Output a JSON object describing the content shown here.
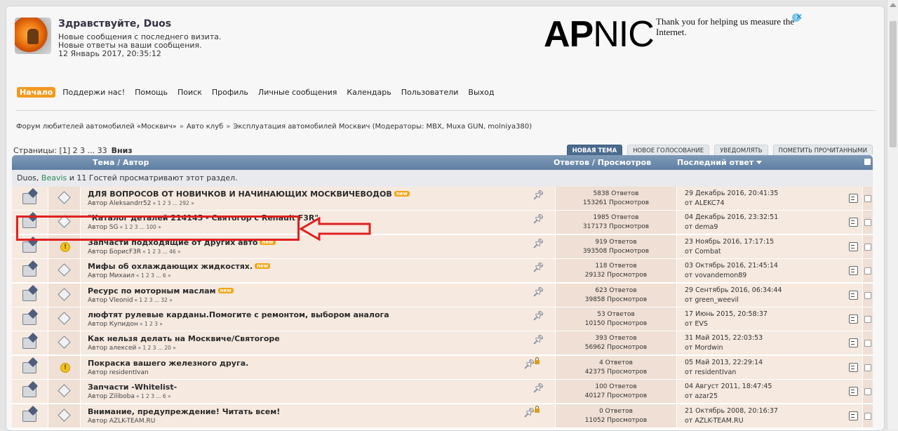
{
  "header": {
    "greeting": "Здравствуйте, Duos",
    "lines": [
      "Новые сообщения с последнего визита.",
      "Новые ответы на ваши сообщения.",
      "12 Январь 2017, 20:35:12"
    ]
  },
  "ad": {
    "logo_bold": "AP",
    "logo_regular": "NIC",
    "text": "Thank you for helping us measure the Internet.",
    "info_glyph": "i",
    "close_glyph": "✕"
  },
  "nav": [
    "Начало",
    "Поддержи нас!",
    "Помощь",
    "Поиск",
    "Профиль",
    "Личные сообщения",
    "Календарь",
    "Пользователи",
    "Выход"
  ],
  "breadcrumb": {
    "items": [
      "Форум любителей автомобилей «Москвич»",
      "Авто клуб",
      "Эксплуатация автомобилей Москвич (Модераторы: MBX, Muxa GUN, molniya380)"
    ],
    "separator": "»"
  },
  "pagination": {
    "label": "Страницы: [1] 2 3 ... 33",
    "down": "Вниз"
  },
  "buttons": [
    "НОВАЯ ТЕМА",
    "НОВОЕ ГОЛОСОВАНИЕ",
    "УВЕДОМЛЯТЬ",
    "ПОМЕТИТЬ ПРОЧИТАННЫМИ"
  ],
  "table_head": {
    "topic": "Тема / Автор",
    "stats": "Ответов / Просмотров",
    "last": "Последний ответ"
  },
  "viewers": {
    "a": "Duos, ",
    "b": "Beavis",
    "c": " и 11 Гостей просматривают этот раздел."
  },
  "topics": [
    {
      "title": "ДЛЯ ВОПРОСОВ ОТ НОВИЧКОВ И НАЧИНАЮЩИХ МОСКВИЧЕВОДОВ",
      "new": "new",
      "author": "Автор Aleksandrr52",
      "pages": "« 1 2 3 ... 292 »",
      "replies": "5838 Ответов",
      "views": "153261 Просмотров",
      "last_date": "29 Декабрь 2016, 20:41:35",
      "last_by": "от ALEKC74",
      "icon": "diamond",
      "locked": false
    },
    {
      "title": "\"Каталог деталей 214145 - Святогор с Renault F3R\"",
      "new": "",
      "author": "Автор SG",
      "pages": "« 1 2 3 ... 100 »",
      "replies": "1985 Ответов",
      "views": "317173 Просмотров",
      "last_date": "04 Декабрь 2016, 23:32:51",
      "last_by": "от dema9",
      "icon": "diamond",
      "locked": false
    },
    {
      "title": "Запчасти подходящие от других авто",
      "new": "new",
      "author": "Автор БорисF3R",
      "pages": "« 1 2 3 ... 46 »",
      "replies": "919 Ответов",
      "views": "393508 Просмотров",
      "last_date": "23 Ноябрь 2016, 17:17:15",
      "last_by": "от Combat",
      "icon": "warn",
      "locked": false
    },
    {
      "title": "Мифы об охлаждающих жидкостях.",
      "new": "new",
      "author": "Автор Михаил",
      "pages": "« 1 2 3 ... 6 »",
      "replies": "118 Ответов",
      "views": "29132 Просмотров",
      "last_date": "03 Октябрь 2016, 21:45:14",
      "last_by": "от vovandemon89",
      "icon": "diamond",
      "locked": false
    },
    {
      "title": "Ресурс по моторным маслам",
      "new": "new",
      "author": "Автор Vleonid",
      "pages": "« 1 2 3 ... 32 »",
      "replies": "623 Ответов",
      "views": "39858 Просмотров",
      "last_date": "29 Сентябрь 2016, 06:34:44",
      "last_by": "от green_weevil",
      "icon": "diamond",
      "locked": false
    },
    {
      "title": "люфтят рулевые карданы.Помогите с ремонтом, выбором аналога",
      "new": "",
      "author": "Автор Купидон",
      "pages": "« 1 2 3 »",
      "replies": "53 Ответов",
      "views": "10150 Просмотров",
      "last_date": "17 Июнь 2015, 20:58:37",
      "last_by": "от EVS",
      "icon": "diamond",
      "locked": false
    },
    {
      "title": "Как нельзя делать на Москвиче/Святогоре",
      "new": "",
      "author": "Автор алексей",
      "pages": "« 1 2 3 ... 20 »",
      "replies": "393 Ответов",
      "views": "56962 Просмотров",
      "last_date": "31 Май 2015, 22:03:53",
      "last_by": "от Mordwin",
      "icon": "diamond",
      "locked": false
    },
    {
      "title": "Покраска вашего железного друга.",
      "new": "",
      "author": "Автор residentIvan",
      "pages": "",
      "replies": "4 Ответов",
      "views": "42375 Просмотров",
      "last_date": "05 Май 2013, 22:29:14",
      "last_by": "от residentIvan",
      "icon": "warn",
      "locked": true
    },
    {
      "title": "Запчасти -Whitelist-",
      "new": "",
      "author": "Автор Ziliboba",
      "pages": "« 1 2 3 ... 6 »",
      "replies": "100 Ответов",
      "views": "40127 Просмотров",
      "last_date": "04 Август 2011, 18:47:45",
      "last_by": "от azar25",
      "icon": "diamond",
      "locked": false
    },
    {
      "title": "Внимание, предупреждение! Читать всем!",
      "new": "",
      "author": "Автор AZLK-TEAM.RU",
      "pages": "",
      "replies": "0 Ответов",
      "views": "11052 Просмотров",
      "last_date": "21 Октябрь 2008, 20:16:37",
      "last_by": "от AZLK-TEAM.RU",
      "icon": "diamond",
      "locked": true
    }
  ],
  "colors": {
    "accent_nav": "#f29a1f",
    "header_bar": "#5f7fa3",
    "highlight": "#e0201f",
    "new_badge": "#f2a516"
  }
}
